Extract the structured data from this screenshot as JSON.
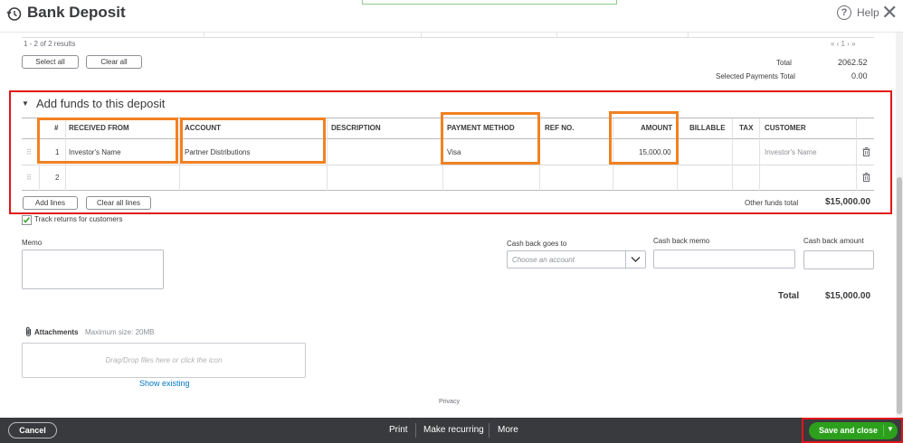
{
  "header": {
    "title": "Bank Deposit",
    "help_label": "Help"
  },
  "results": {
    "count_label": "1 - 2 of 2 results",
    "pagination": "« ‹ 1 › »"
  },
  "top_buttons": {
    "select_all": "Select all",
    "clear_all": "Clear all"
  },
  "summary": {
    "total_label": "Total",
    "total_value": "2062.52",
    "selected_label": "Selected Payments Total",
    "selected_value": "0.00"
  },
  "section": {
    "title": "Add funds to this deposit",
    "toggle": "▼"
  },
  "table": {
    "columns": {
      "num": "#",
      "received_from": "RECEIVED FROM",
      "account": "ACCOUNT",
      "description": "DESCRIPTION",
      "payment_method": "PAYMENT METHOD",
      "ref_no": "REF NO.",
      "amount": "AMOUNT",
      "billable": "BILLABLE",
      "tax": "TAX",
      "customer": "CUSTOMER"
    },
    "rows": [
      {
        "num": "1",
        "received_from": "Investor's Name",
        "account": "Partner Distributions",
        "payment_method": "Visa",
        "amount": "15,000.00",
        "customer": "Investor's Name"
      },
      {
        "num": "2"
      }
    ]
  },
  "table_buttons": {
    "add_lines": "Add lines",
    "clear_all_lines": "Clear all lines"
  },
  "other_funds": {
    "label": "Other funds total",
    "value": "$15,000.00"
  },
  "track_returns": {
    "label": "Track returns for customers",
    "checked": true
  },
  "memo": {
    "label": "Memo"
  },
  "cash_back": {
    "goes_to_label": "Cash back goes to",
    "goes_to_placeholder": "Choose an account",
    "memo_label": "Cash back memo",
    "amount_label": "Cash back amount"
  },
  "total": {
    "label": "Total",
    "value": "$15,000.00"
  },
  "attachments": {
    "label": "Attachments",
    "max_size": "Maximum size: 20MB",
    "drop_text": "Drag/Drop files here or click the icon",
    "show_existing": "Show existing"
  },
  "privacy": "Privacy",
  "footer": {
    "cancel": "Cancel",
    "print": "Print",
    "make_recurring": "Make recurring",
    "more": "More",
    "save_and_close": "Save and close"
  },
  "colors": {
    "accent_green": "#2ca01c",
    "annotation_red": "#e3151a",
    "annotation_orange": "#f28121",
    "footer_bg": "#393a3d"
  }
}
